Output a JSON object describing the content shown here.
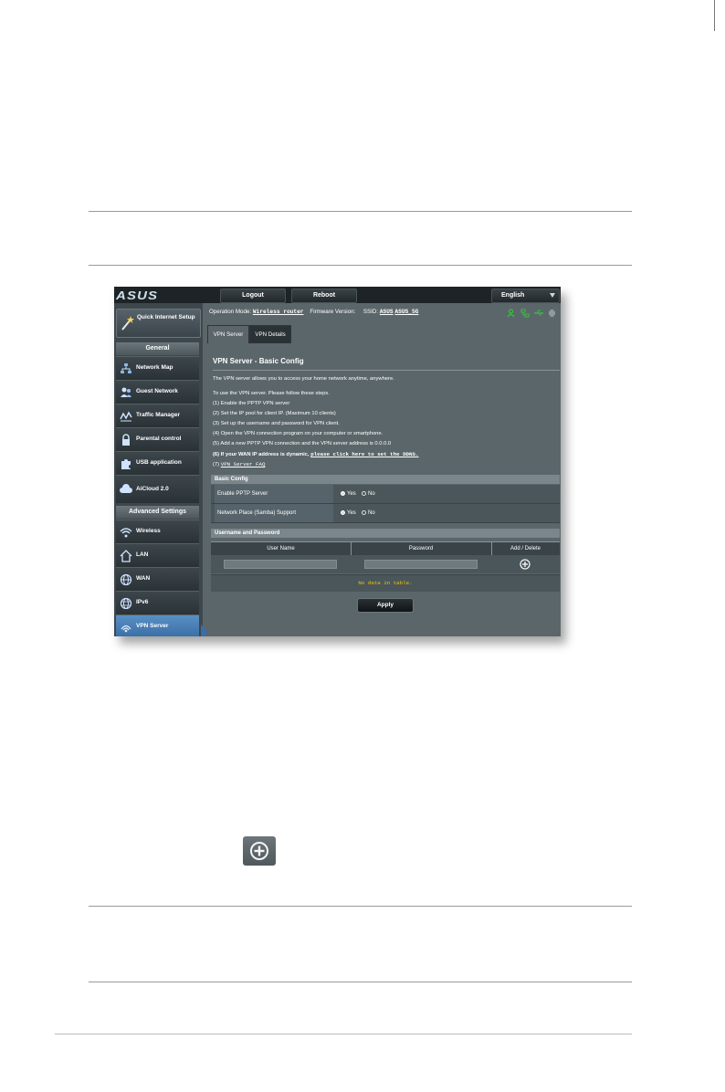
{
  "header": {
    "logout": "Logout",
    "reboot": "Reboot",
    "language": "English"
  },
  "sidebar": {
    "quick_setup": "Quick Internet Setup",
    "general_label": "General",
    "general_items": [
      {
        "label": "Network Map",
        "icon": "network-map-icon"
      },
      {
        "label": "Guest Network",
        "icon": "guest-network-icon"
      },
      {
        "label": "Traffic Manager",
        "icon": "traffic-manager-icon"
      },
      {
        "label": "Parental control",
        "icon": "lock-icon"
      },
      {
        "label": "USB application",
        "icon": "puzzle-icon"
      },
      {
        "label": "AiCloud 2.0",
        "icon": "cloud-icon"
      }
    ],
    "advanced_label": "Advanced Settings",
    "advanced_items": [
      {
        "label": "Wireless",
        "icon": "wifi-icon"
      },
      {
        "label": "LAN",
        "icon": "home-icon"
      },
      {
        "label": "WAN",
        "icon": "globe-icon"
      },
      {
        "label": "IPv6",
        "icon": "ipv6-globe-icon"
      },
      {
        "label": "VPN Server",
        "icon": "vpn-icon"
      }
    ]
  },
  "status": {
    "op_mode_label": "Operation Mode:",
    "op_mode_value": "Wireless router",
    "firmware_label": "Firmware Version:",
    "ssid_label": "SSID:",
    "ssid_1": "ASUS",
    "ssid_2": "ASUS_5G"
  },
  "tabs": [
    "VPN Server",
    "VPN Details"
  ],
  "page": {
    "title": "VPN Server - Basic Config",
    "intro": "The VPN server allows you to access your home network anytime, anywhere.",
    "steps_intro": "To use the VPN server. Please follow these steps.",
    "steps": [
      "(1) Enable the PPTP VPN server",
      "(2) Set the IP pool for client IP. (Maximum 10 clients)",
      "(3) Set up the username and password for VPN client.",
      "(4) Open the VPN connection program on your computer or smartphone.",
      "(5) Add a new PPTP VPN connection and the VPN server address is 0.0.0.0"
    ],
    "step6_prefix": "(6) If your WAN IP address is dynamic,",
    "step6_link": "please click here to set the DDNS.",
    "step7_prefix": "(7)",
    "step7_link": "VPN Server FAQ"
  },
  "basic_config": {
    "header": "Basic Config",
    "rows": [
      {
        "label": "Enable PPTP Server",
        "yes": "Yes",
        "no": "No",
        "selected": "yes"
      },
      {
        "label": "Network Place (Samba) Support",
        "yes": "Yes",
        "no": "No",
        "selected": "yes"
      }
    ]
  },
  "users": {
    "header": "Username and Password",
    "columns": [
      "User Name",
      "Password",
      "Add / Delete"
    ],
    "empty_text": "No data in table."
  },
  "apply_label": "Apply",
  "colors": {
    "active_nav": "#3a6fa6",
    "empty_text": "#f5c400",
    "status_icons": "#39c03c"
  }
}
